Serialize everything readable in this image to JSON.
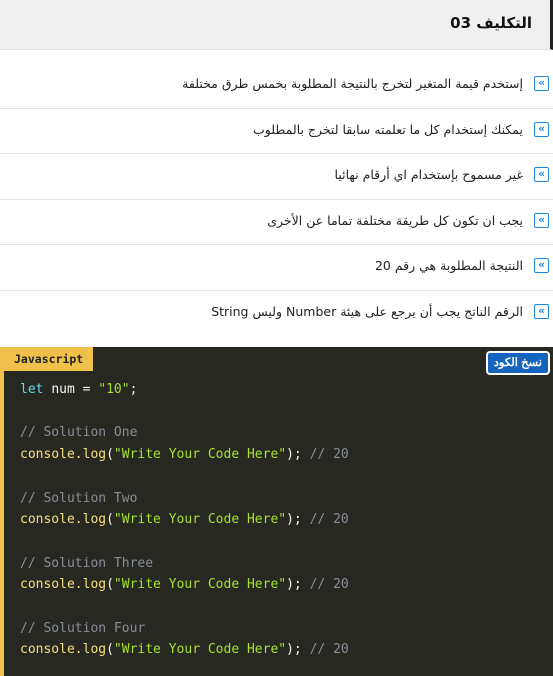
{
  "header": {
    "title": "التكليف 03"
  },
  "requirements": [
    "إستخدم قيمة المتغير لتخرج بالنتيجة المطلوبة بخمس طرق مختلفة",
    "يمكنك إستخدام كل ما تعلمته سابقا لتخرج بالمطلوب",
    "غير مسموح بإستخدام اي أرقام نهائيا",
    "يجب ان تكون كل طريقة مختلفة تماما عن الأخرى",
    "النتيجة المطلوبة هي رقم 20",
    "الرقم الناتج يجب أن يرجع على هيئة Number وليس String"
  ],
  "bullet_glyph": "»",
  "code_block": {
    "language": "Javascript",
    "copy_label": "نسخ الكود",
    "declaration": {
      "keyword": "let",
      "name": "num",
      "op": " = ",
      "value": "\"10\"",
      "end": ";"
    },
    "solutions": [
      {
        "comment": "// Solution One",
        "call": "console.log",
        "arg": "\"Write Your Code Here\"",
        "end": ");",
        "result": "// 20"
      },
      {
        "comment": "// Solution Two",
        "call": "console.log",
        "arg": "\"Write Your Code Here\"",
        "end": ");",
        "result": "// 20"
      },
      {
        "comment": "// Solution Three",
        "call": "console.log",
        "arg": "\"Write Your Code Here\"",
        "end": ");",
        "result": "// 20"
      },
      {
        "comment": "// Solution Four",
        "call": "console.log",
        "arg": "\"Write Your Code Here\"",
        "end": ");",
        "result": "// 20"
      }
    ]
  },
  "colors": {
    "accent_blue": "#1e88e5",
    "code_bg": "#272822",
    "lang_badge": "#f1c04b",
    "copy_button": "#1565c0"
  }
}
